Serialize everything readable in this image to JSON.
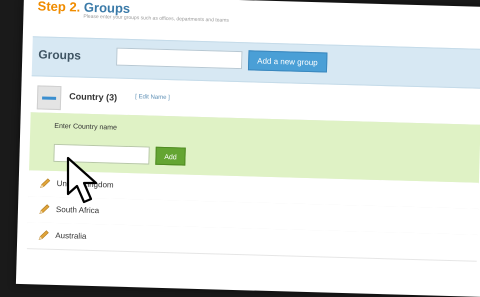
{
  "step": {
    "prefix": "Step 2.",
    "title": "Groups",
    "subtitle": "Please enter your groups such as offices, departments and teams"
  },
  "groups_bar": {
    "label": "Groups",
    "input_value": "",
    "add_button": "Add a new group"
  },
  "country_group": {
    "title": "Country (3)",
    "edit_link": "[ Edit Name ]",
    "enter_label": "Enter Country name",
    "input_value": "",
    "add_button": "Add"
  },
  "countries": [
    {
      "label": "United Kingdom"
    },
    {
      "label": "South Africa"
    },
    {
      "label": "Australia"
    }
  ],
  "colors": {
    "accent": "#3a7aa8",
    "step_prefix": "#f08c00",
    "green_panel": "#dff2c5",
    "add_button": "#64a532",
    "blue_button": "#4a9fd6"
  }
}
